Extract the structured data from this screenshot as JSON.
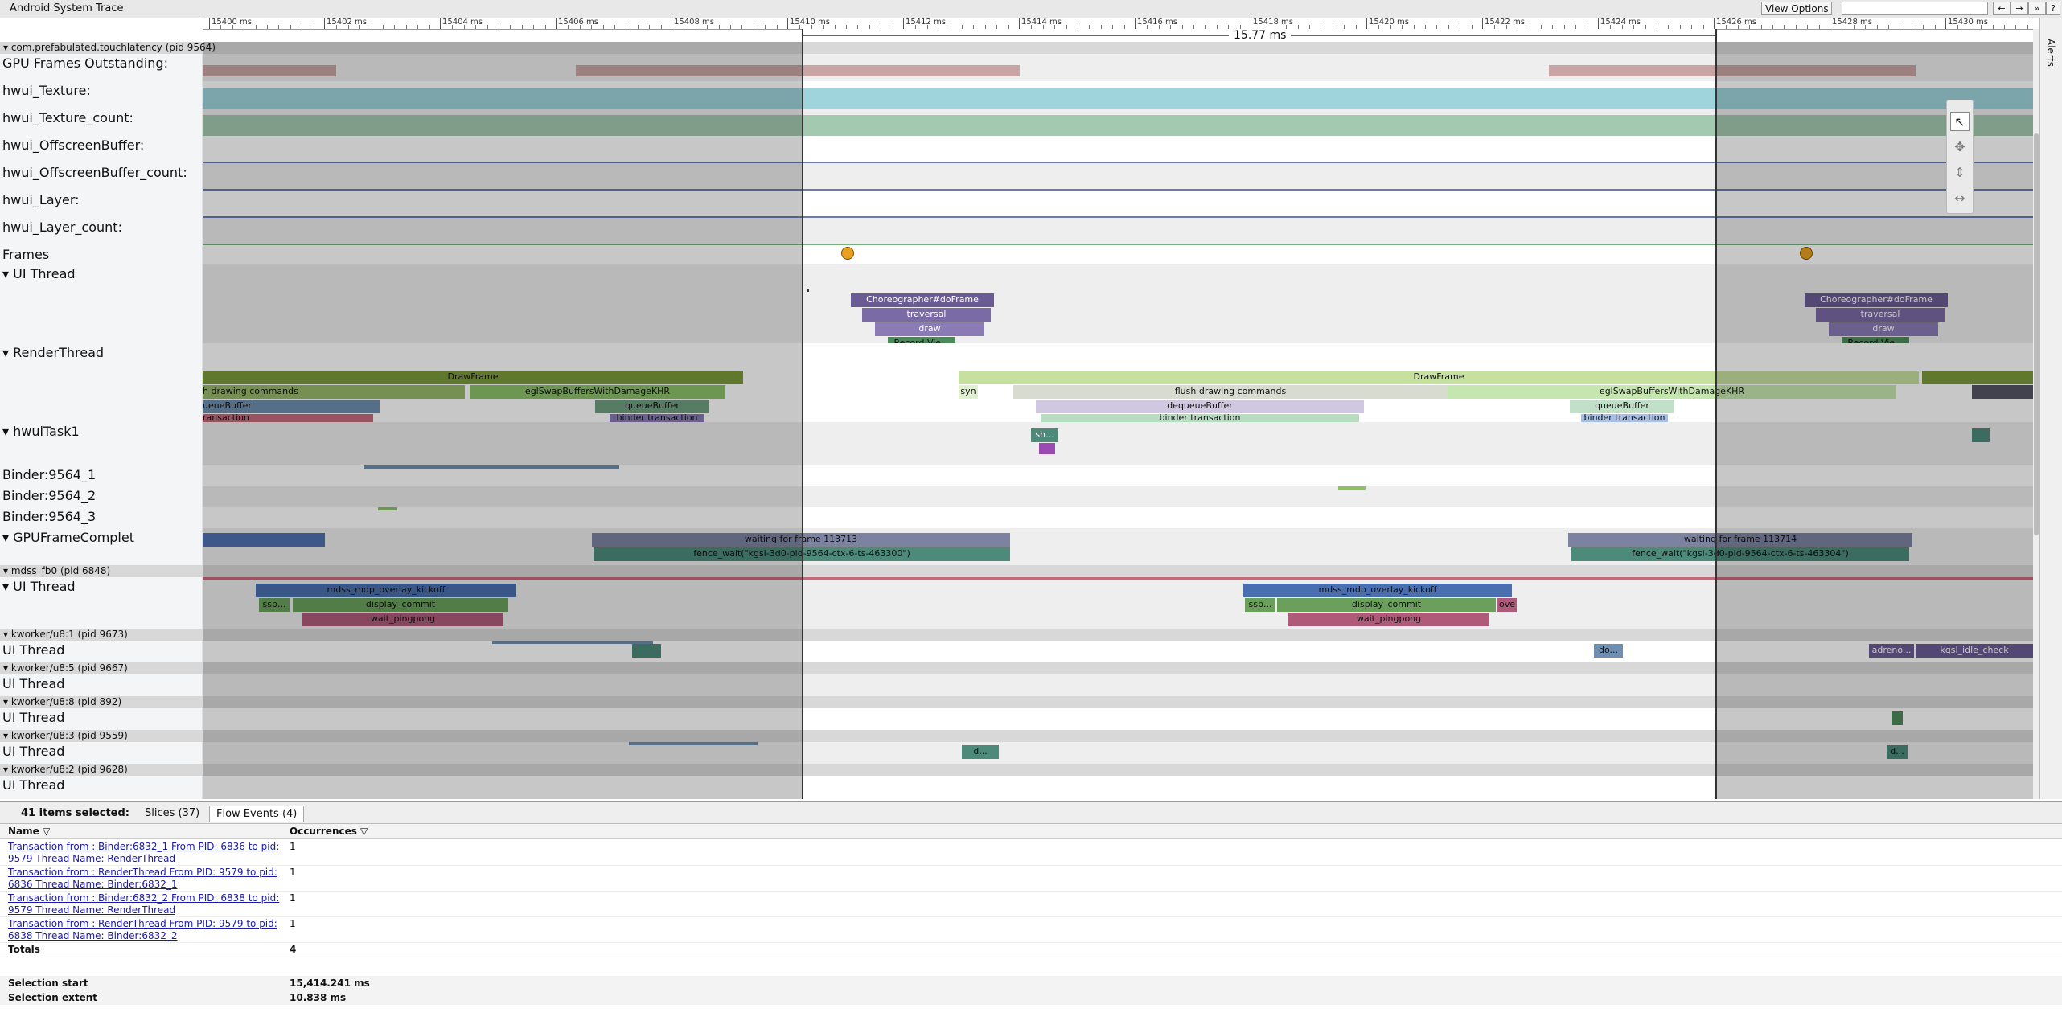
{
  "window": {
    "title": "Android System Trace"
  },
  "toolbar": {
    "view_options": "View Options ▾",
    "search_placeholder": "",
    "prev": "←",
    "next": "→",
    "expand": "»",
    "help": "?"
  },
  "ruler": {
    "ticks": [
      "15400 ms",
      "15402 ms",
      "15404 ms",
      "15406 ms",
      "15408 ms",
      "15410 ms",
      "15412 ms",
      "15414 ms",
      "15416 ms",
      "15418 ms",
      "15420 ms",
      "15422 ms",
      "15424 ms",
      "15426 ms",
      "15428 ms",
      "15430 ms"
    ]
  },
  "selection": {
    "duration_label": "15.77 ms"
  },
  "alerts": {
    "label": "Alerts"
  },
  "processes": [
    "▾ com.prefabulated.touchlatency (pid 9564)",
    "▾ mdss_fb0 (pid 6848)",
    "▾ kworker/u8:1 (pid 9673)",
    "▾ kworker/u8:5 (pid 9667)",
    "▾ kworker/u8:8 (pid 892)",
    "▾ kworker/u8:3 (pid 9559)",
    "▾ kworker/u8:2 (pid 9628)"
  ],
  "tracks": {
    "gpu_frames": "GPU Frames Outstanding:",
    "hwui_texture": "hwui_Texture:",
    "hwui_texture_count": "hwui_Texture_count:",
    "hwui_offscreen": "hwui_OffscreenBuffer:",
    "hwui_offscreen_count": "hwui_OffscreenBuffer_count:",
    "hwui_layer": "hwui_Layer:",
    "hwui_layer_count": "hwui_Layer_count:",
    "frames": "Frames",
    "ui_thread": "▾ UI Thread",
    "render_thread": "▾ RenderThread",
    "hwui_task": "▾ hwuiTask1",
    "binder1": "Binder:9564_1",
    "binder2": "Binder:9564_2",
    "binder3": "Binder:9564_3",
    "gpu_complete": "▾ GPUFrameComplet",
    "mdss_ui": "▾ UI Thread",
    "k1_ui": "UI Thread",
    "k5_ui": "UI Thread",
    "k8_ui": "UI Thread",
    "k3_ui": "UI Thread",
    "k2_ui": "UI Thread"
  },
  "slices": {
    "choreographer": "Choreographer#doFrame",
    "traversal": "traversal",
    "draw": "draw",
    "record_view": "Record Vie...",
    "draw_frame": "DrawFrame",
    "flush_drawing": "flush drawing commands",
    "flush_drawing_left": "h drawing commands",
    "egl_swap": "eglSwapBuffersWithDamageKHR",
    "queue_buffer": "queueBuffer",
    "queue_buffer_left": "ueueBuffer",
    "dequeue_buffer": "dequeueBuffer",
    "binder_transaction": "binder transaction",
    "binder_transaction_left": "ransaction",
    "syn": "syn",
    "sh": "sh...",
    "waiting_113713": "waiting for frame 113713",
    "waiting_113714": "waiting for frame 113714",
    "fence_463300": "fence_wait(\"kgsl-3d0-pid-9564-ctx-6-ts-463300\")",
    "fence_463304": "fence_wait(\"kgsl-3d0-pid-9564-ctx-6-ts-463304\")",
    "mdp_kickoff": "mdss_mdp_overlay_kickoff",
    "display_commit": "display_commit",
    "wait_pingpong": "wait_pingpong",
    "ssp": "ssp...",
    "ove": "ove",
    "do": "do...",
    "adreno": "adreno...",
    "kgsl_idle": "kgsl_idle_check",
    "d": "d..."
  },
  "bottom": {
    "selected_count": "41 items selected:",
    "tab_slices": "Slices (37)",
    "tab_flow": "Flow Events (4)",
    "col_name": "Name ▽",
    "col_occ": "Occurrences ▽",
    "rows": [
      {
        "name": "Transaction from : Binder:6832_1 From PID: 6836 to pid: 9579 Thread Name: RenderThread",
        "occ": "1"
      },
      {
        "name": "Transaction from : RenderThread From PID: 9579 to pid: 6836 Thread Name: Binder:6832_1",
        "occ": "1"
      },
      {
        "name": "Transaction from : Binder:6832_2 From PID: 6838 to pid: 9579 Thread Name: RenderThread",
        "occ": "1"
      },
      {
        "name": "Transaction from : RenderThread From PID: 9579 to pid: 6838 Thread Name: Binder:6832_2",
        "occ": "1"
      }
    ],
    "totals_label": "Totals",
    "totals_value": "4",
    "sel_start_label": "Selection start",
    "sel_start_value": "15,414.241 ms",
    "sel_extent_label": "Selection extent",
    "sel_extent_value": "10.838 ms"
  },
  "colors": {
    "choreographer": "#6b5b95",
    "drawframe": "#7a9a3a",
    "drawframe_light": "#c6e0a0",
    "egl": "#8cc06b",
    "queue": "#6f8fb0",
    "binder": "#c46a7a",
    "fence": "#4d8a7a",
    "waiting": "#7c83a0",
    "mdp": "#4a6fb0",
    "display": "#6aa05a",
    "pingpong": "#b05a7a"
  }
}
